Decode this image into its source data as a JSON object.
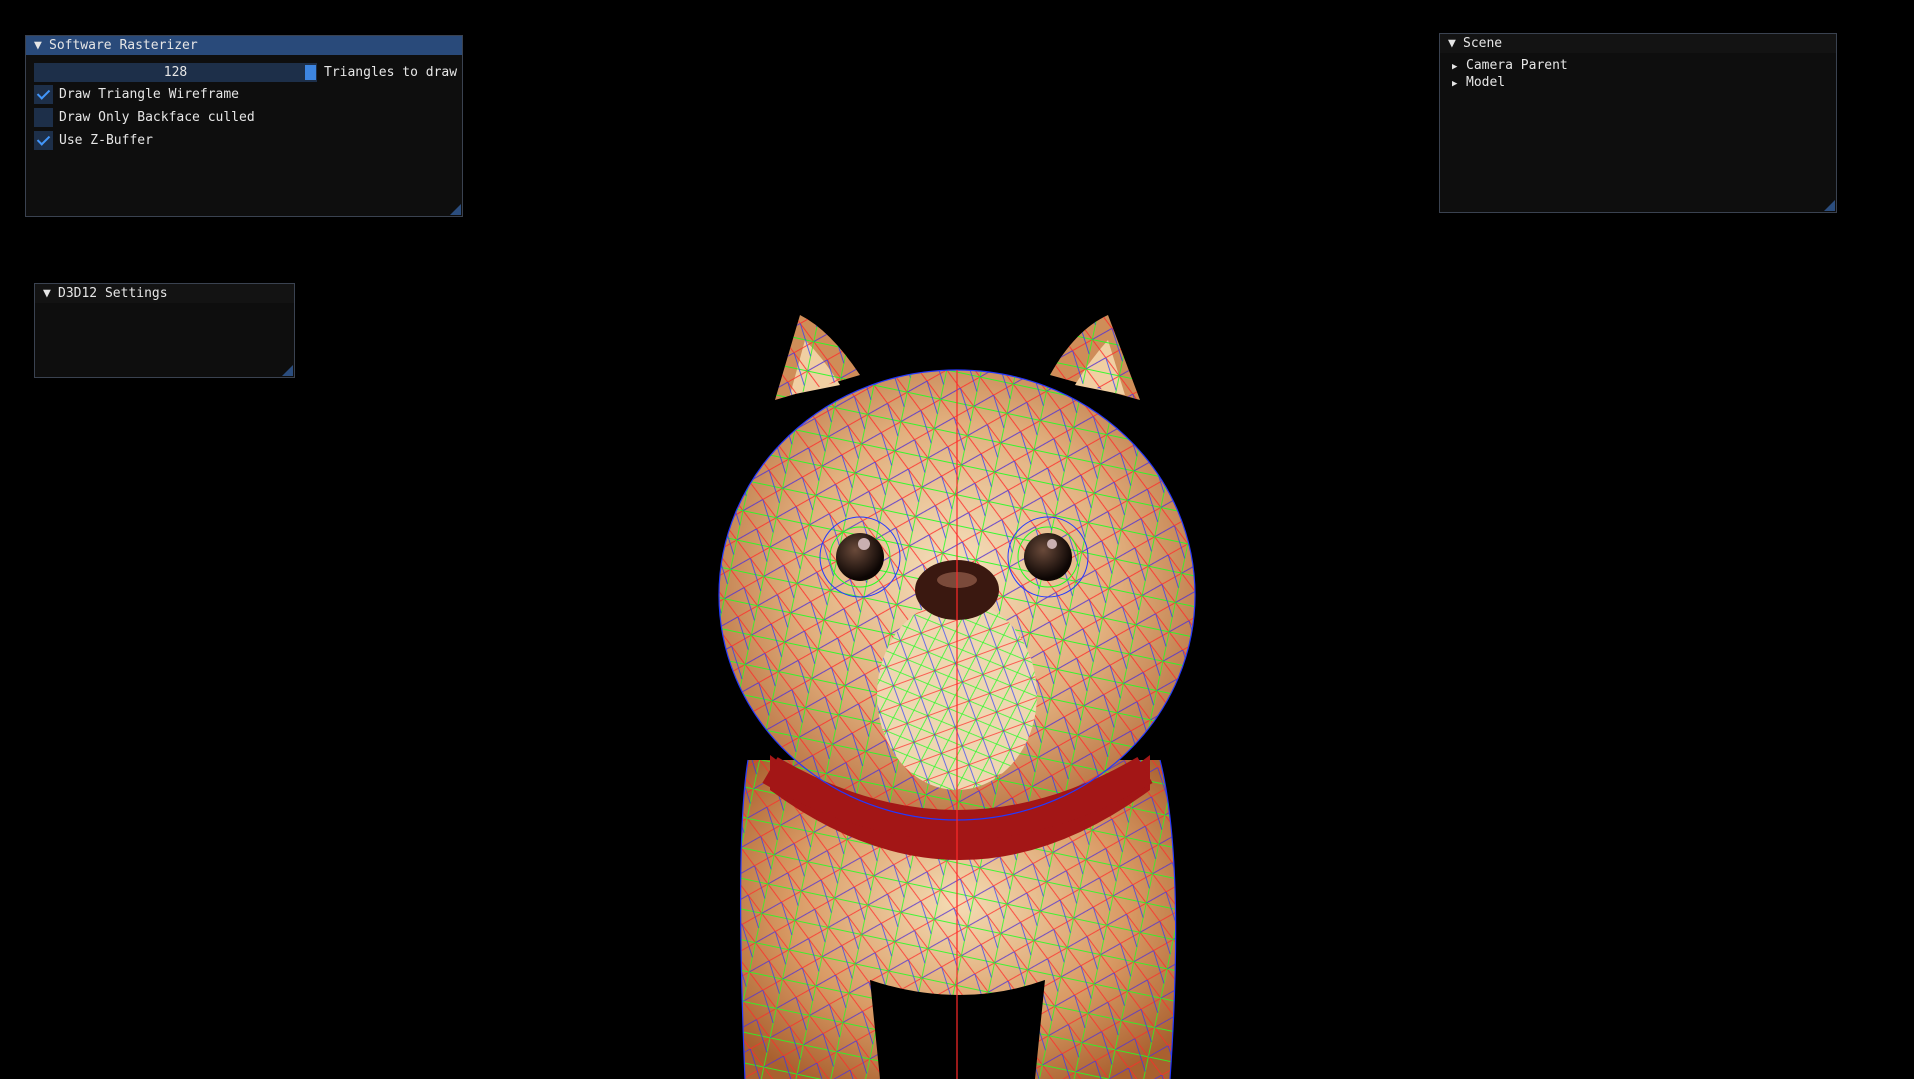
{
  "viewport": {
    "description_label": "3D render viewport",
    "colors": {
      "background": "#000000",
      "fur_base": "#c98a56",
      "fur_light": "#f3dcb8",
      "collar": "#a31616",
      "wire_red": "#ff2020",
      "wire_green": "#20ff20",
      "wire_blue": "#2030ff"
    }
  },
  "software_rasterizer": {
    "title": "Software Rasterizer",
    "slider_value": "128",
    "slider_label": "Triangles to draw",
    "checkboxes": [
      {
        "label": "Draw Triangle Wireframe",
        "checked": true
      },
      {
        "label": "Draw Only Backface culled",
        "checked": false
      },
      {
        "label": "Use Z-Buffer",
        "checked": true
      }
    ]
  },
  "d3d12": {
    "title": "D3D12 Settings"
  },
  "scene": {
    "title": "Scene",
    "items": [
      "Camera Parent",
      "Model"
    ]
  },
  "icons": {
    "expanded": "▼",
    "collapsed": "▶"
  }
}
